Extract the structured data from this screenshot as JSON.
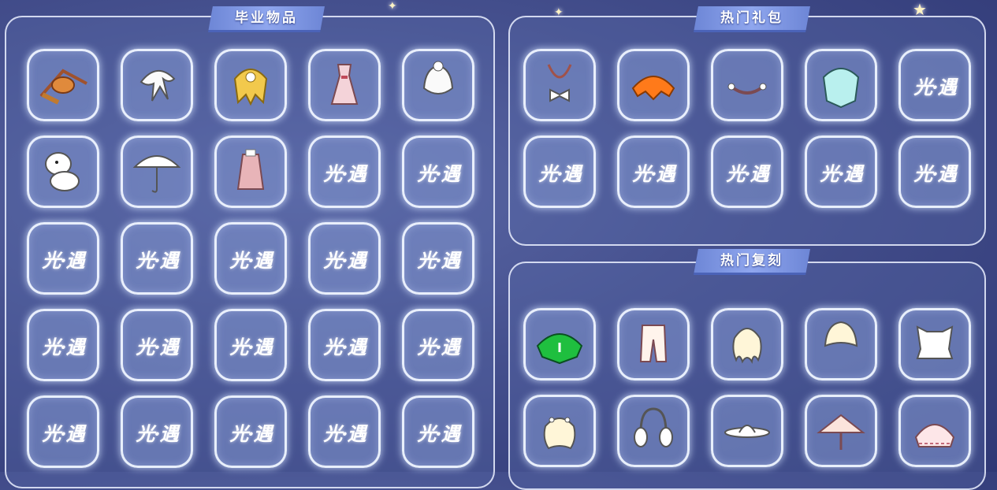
{
  "sections": {
    "graduation": {
      "title": "毕业物品"
    },
    "hot_packs": {
      "title": "热门礼包"
    },
    "hot_rerun": {
      "title": "热门复刻"
    }
  },
  "placeholder_logo": "光·遇",
  "graduation_items": [
    "hand-chime-icon",
    "white-hair-icon",
    "golden-cape-icon",
    "pink-dress-icon",
    "white-hat-icon",
    "moomin-icon",
    "umbrella-icon",
    "pink-coat-icon",
    "placeholder",
    "placeholder",
    "placeholder",
    "placeholder",
    "placeholder",
    "placeholder",
    "placeholder",
    "placeholder",
    "placeholder",
    "placeholder",
    "placeholder",
    "placeholder",
    "placeholder",
    "placeholder",
    "placeholder",
    "placeholder",
    "placeholder"
  ],
  "hot_pack_items": [
    "bow-necklace-icon",
    "orange-cape-icon",
    "mask-necklace-icon",
    "teal-cape-icon",
    "placeholder",
    "placeholder",
    "placeholder",
    "placeholder",
    "placeholder",
    "placeholder"
  ],
  "hot_rerun_items": [
    "green-cape-icon",
    "white-pants-icon",
    "wavy-hair-icon",
    "short-hair-icon",
    "white-top-icon",
    "flower-hair-icon",
    "earmuffs-icon",
    "white-hat-brim-icon",
    "straw-hat-icon",
    "lace-cape-icon"
  ],
  "colors": {
    "panel_border": "#ebf0ff",
    "title_bar": "#8fa6ee",
    "background": "#45508e"
  }
}
